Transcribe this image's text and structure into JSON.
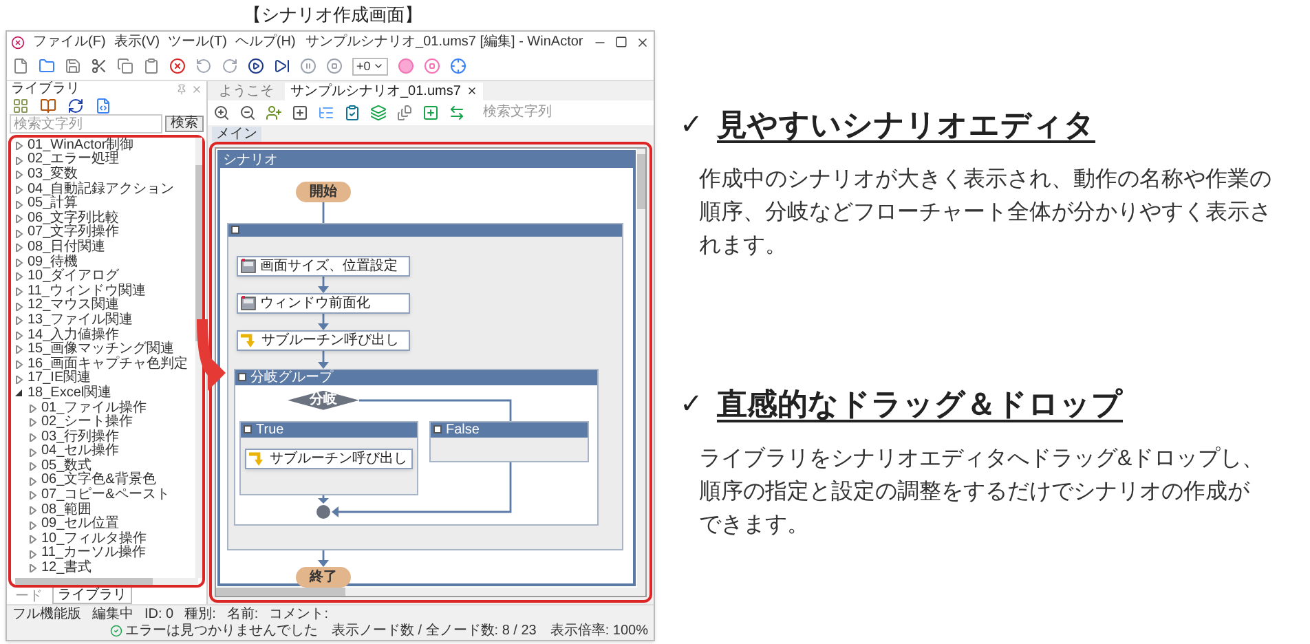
{
  "caption": "【シナリオ作成画面】",
  "window": {
    "title": "サンプルシナリオ_01.ums7 [編集] - WinActor",
    "menu": [
      "ファイル(F)",
      "表示(V)",
      "ツール(T)",
      "ヘルプ(H)"
    ],
    "speed": "+0"
  },
  "library": {
    "title": "ライブラリ",
    "search_placeholder": "検索文字列",
    "search_button": "検索",
    "tree": [
      {
        "label": "01_WinActor制御",
        "expanded": false
      },
      {
        "label": "02_エラー処理",
        "expanded": false
      },
      {
        "label": "03_変数",
        "expanded": false
      },
      {
        "label": "04_自動記録アクション",
        "expanded": false
      },
      {
        "label": "05_計算",
        "expanded": false
      },
      {
        "label": "06_文字列比較",
        "expanded": false
      },
      {
        "label": "07_文字列操作",
        "expanded": false
      },
      {
        "label": "08_日付関連",
        "expanded": false
      },
      {
        "label": "09_待機",
        "expanded": false
      },
      {
        "label": "10_ダイアログ",
        "expanded": false
      },
      {
        "label": "11_ウィンドウ関連",
        "expanded": false
      },
      {
        "label": "12_マウス関連",
        "expanded": false
      },
      {
        "label": "13_ファイル関連",
        "expanded": false
      },
      {
        "label": "14_入力値操作",
        "expanded": false
      },
      {
        "label": "15_画像マッチング関連",
        "expanded": false
      },
      {
        "label": "16_画面キャプチャ色判定",
        "expanded": false
      },
      {
        "label": "17_IE関連",
        "expanded": false
      },
      {
        "label": "18_Excel関連",
        "expanded": true,
        "children": [
          {
            "label": "01_ファイル操作",
            "expanded": false
          },
          {
            "label": "02_シート操作",
            "expanded": false
          },
          {
            "label": "03_行列操作",
            "expanded": false
          },
          {
            "label": "04_セル操作",
            "expanded": false
          },
          {
            "label": "05_数式",
            "expanded": false
          },
          {
            "label": "06_文字色&背景色",
            "expanded": false
          },
          {
            "label": "07_コピー&ペースト",
            "expanded": false
          },
          {
            "label": "08_範囲",
            "expanded": false
          },
          {
            "label": "09_セル位置",
            "expanded": false
          },
          {
            "label": "10_フィルタ操作",
            "expanded": false
          },
          {
            "label": "11_カーソル操作",
            "expanded": false
          },
          {
            "label": "12_書式",
            "expanded": false
          }
        ]
      }
    ],
    "tabs": [
      {
        "label": "ード",
        "selected": false
      },
      {
        "label": "ライブラリ",
        "selected": true
      }
    ]
  },
  "editor": {
    "tabs": [
      {
        "label": "ようこそ",
        "selected": false,
        "closable": false
      },
      {
        "label": "サンプルシナリオ_01.ums7",
        "selected": true,
        "closable": true
      }
    ],
    "search_placeholder": "検索文字列",
    "view_tab": "メイン",
    "scenario": {
      "title": "シナリオ",
      "start": "開始",
      "end": "終了",
      "steps": [
        {
          "kind": "action",
          "label": "画面サイズ、位置設定"
        },
        {
          "kind": "action",
          "label": "ウィンドウ前面化"
        },
        {
          "kind": "subroutine",
          "label": "サブルーチン呼び出し"
        }
      ],
      "branch": {
        "title": "分岐グループ",
        "condition": "分岐",
        "true_label": "True",
        "false_label": "False",
        "true_steps": [
          {
            "kind": "subroutine",
            "label": "サブルーチン呼び出し"
          }
        ]
      }
    }
  },
  "status_bar": {
    "left": [
      "フル機能版",
      "編集中",
      "ID: 0",
      "種別:",
      "名前:",
      "コメント:"
    ],
    "message": "エラーは見つかりませんでした",
    "node_count": "表示ノード数 / 全ノード数: 8 / 23",
    "zoom": "表示倍率: 100%"
  },
  "features": [
    {
      "bullet": "✓",
      "title": "見やすいシナリオエディタ",
      "body_lines": [
        "作成中のシナリオが大きく表示され、動作の名称や作業の",
        "順序、分岐などフローチャート全体が分かりやすく表示さ",
        "れます。"
      ]
    },
    {
      "bullet": "✓",
      "title": "直感的なドラッグ＆ドロップ",
      "body_lines": [
        "ライブラリをシナリオエディタへドラッグ&ドロップし、",
        "順序の指定と設定の調整をするだけでシナリオの作成が",
        "できます。"
      ]
    }
  ]
}
